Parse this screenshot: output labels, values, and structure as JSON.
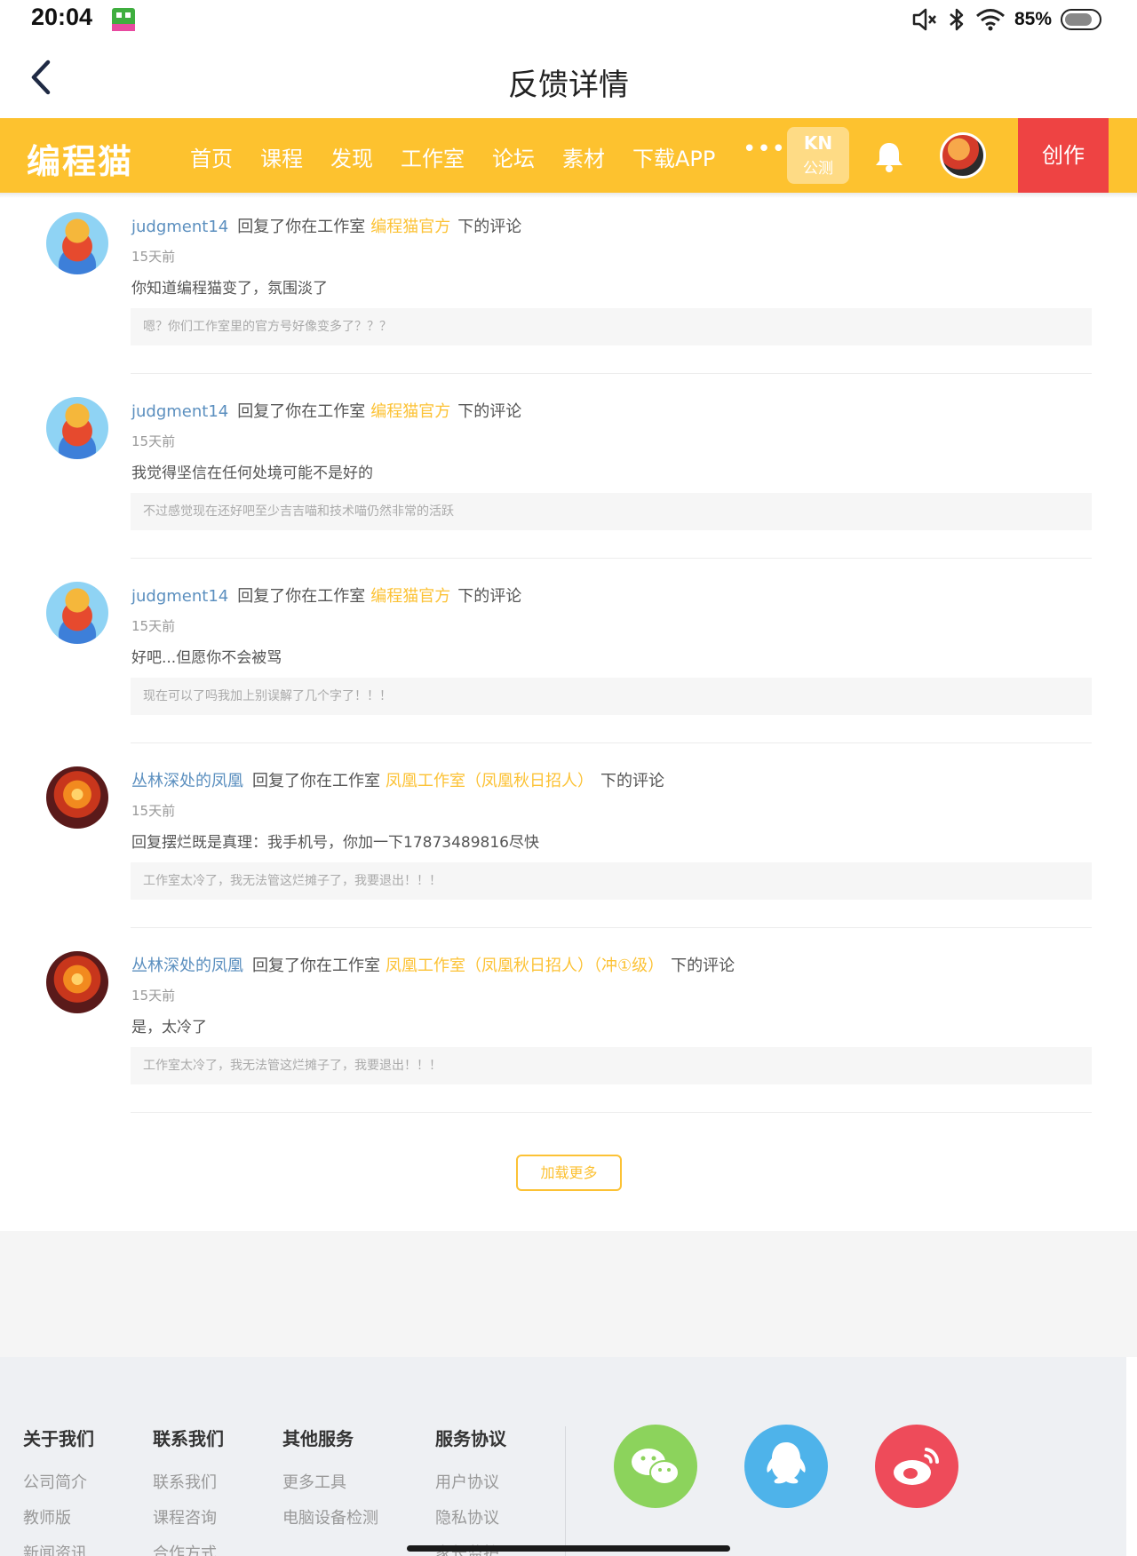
{
  "status_bar": {
    "time": "20:04",
    "battery": "85%",
    "battery_level": 0.85
  },
  "header": {
    "title": "反馈详情"
  },
  "nav": {
    "logo": "编程猫",
    "items": [
      "首页",
      "课程",
      "发现",
      "工作室",
      "论坛",
      "素材",
      "下载APP"
    ],
    "more": "•••",
    "kn_badge_top": "KN",
    "kn_badge_bottom": "公测",
    "create_label": "创作"
  },
  "comments": [
    {
      "user": "judgment14",
      "action": "回复了你在工作室",
      "studio": "编程猫官方",
      "suffix": "下的评论",
      "time": "15天前",
      "content": "你知道编程猫变了，氛围淡了",
      "quote": "嗯？你们工作室里的官方号好像变多了？？？"
    },
    {
      "user": "judgment14",
      "action": "回复了你在工作室",
      "studio": "编程猫官方",
      "suffix": "下的评论",
      "time": "15天前",
      "content": "我觉得坚信在任何处境可能不是好的",
      "quote": "不过感觉现在还好吧至少吉吉喵和技术喵仍然非常的活跃"
    },
    {
      "user": "judgment14",
      "action": "回复了你在工作室",
      "studio": "编程猫官方",
      "suffix": "下的评论",
      "time": "15天前",
      "content": "好吧...但愿你不会被骂",
      "quote": "现在可以了吗我加上别误解了几个字了！！！"
    },
    {
      "user": "丛林深处的凤凰",
      "action": "回复了你在工作室",
      "studio": "凤凰工作室（凤凰秋日招人）",
      "suffix": "下的评论",
      "time": "15天前",
      "content": "回复摆烂既是真理：我手机号，你加一下17873489816尽快",
      "quote": "工作室太冷了，我无法管这烂摊子了，我要退出！！！"
    },
    {
      "user": "丛林深处的凤凰",
      "action": "回复了你在工作室",
      "studio": "凤凰工作室（凤凰秋日招人）（冲①级）",
      "suffix": "下的评论",
      "time": "15天前",
      "content": "是，太冷了",
      "quote": "工作室太冷了，我无法管这烂摊子了，我要退出！！！"
    }
  ],
  "load_more": "加载更多",
  "footer": {
    "columns": [
      {
        "head": "关于我们",
        "links": [
          "公司简介",
          "教师版",
          "新闻资讯"
        ]
      },
      {
        "head": "联系我们",
        "links": [
          "联系我们",
          "课程咨询",
          "合作方式"
        ]
      },
      {
        "head": "其他服务",
        "links": [
          "更多工具",
          "电脑设备检测"
        ]
      },
      {
        "head": "服务协议",
        "links": [
          "用户协议",
          "隐私协议",
          "家长监护"
        ]
      }
    ],
    "social": [
      {
        "name": "wechat",
        "color": "#8cd35c"
      },
      {
        "name": "qq",
        "color": "#4eb3ea"
      },
      {
        "name": "weibo",
        "color": "#ee4b5a"
      }
    ]
  }
}
